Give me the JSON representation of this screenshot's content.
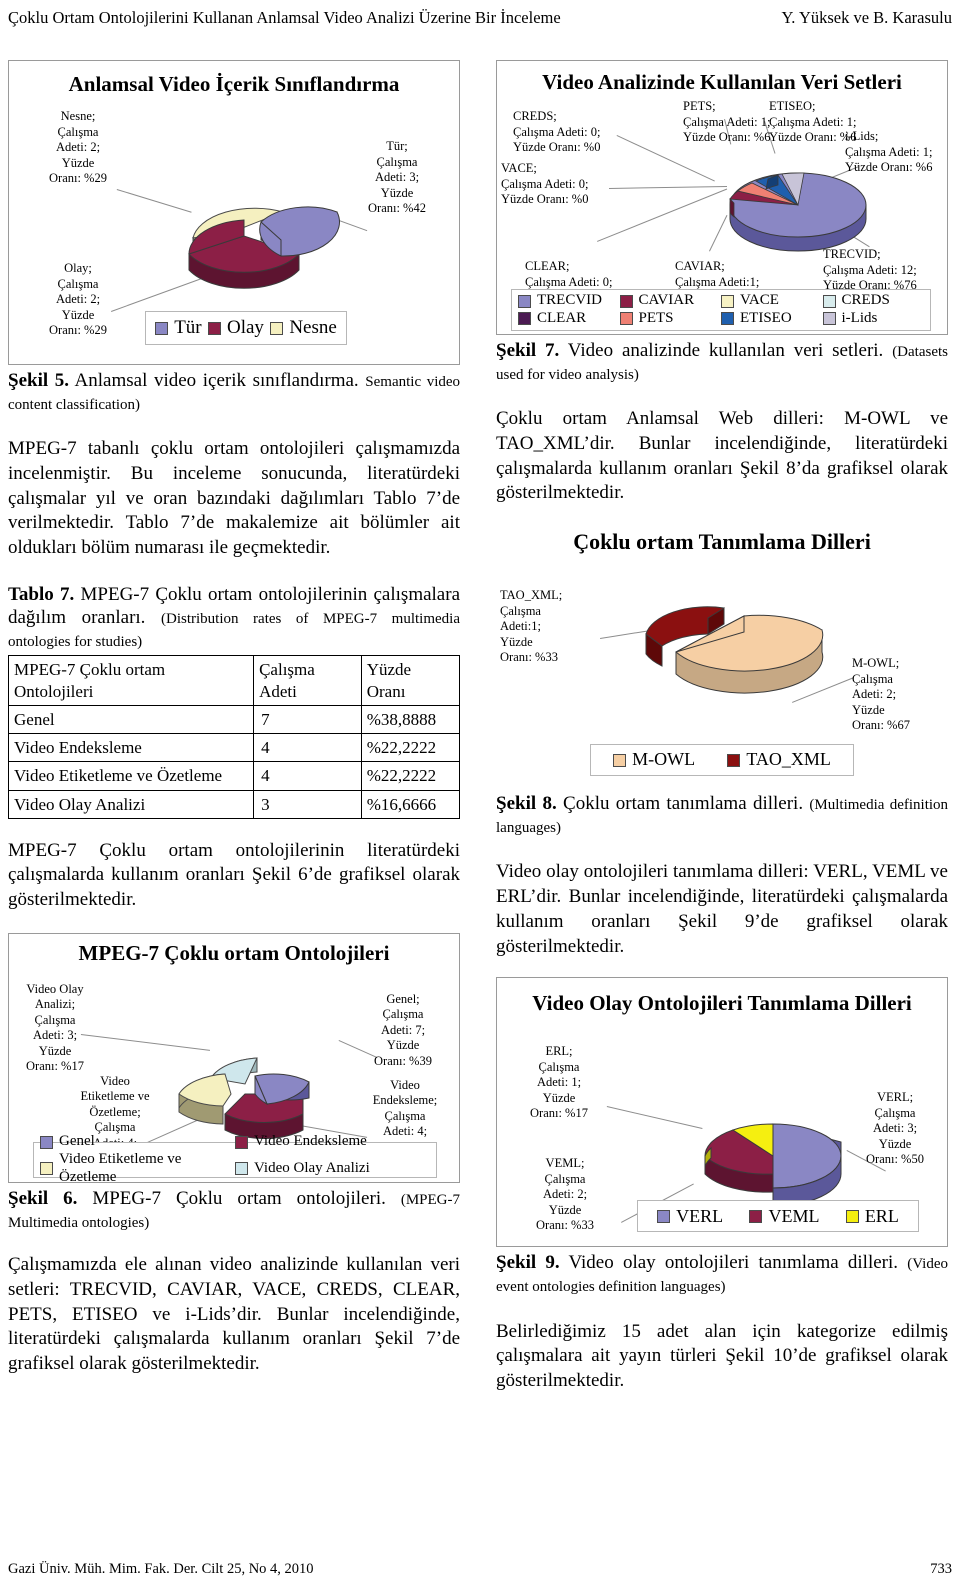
{
  "running_head": {
    "left": "Çoklu Ortam Ontolojilerini Kullanan Anlamsal Video Analizi Üzerine Bir İnceleme",
    "right": "Y. Yüksek ve B. Karasulu"
  },
  "footer": {
    "left": "Gazi Üniv. Müh. Mim. Fak. Der. Cilt 25, No 4, 2010",
    "right": "733"
  },
  "figure5": {
    "caption_bold": "Şekil 5.",
    "caption_tr": "Anlamsal video içerik sınıflandırma.",
    "caption_en": "Semantic video content classification)",
    "chart_data": {
      "type": "pie",
      "title": "Anlamsal Video İçerik Sınıflandırma",
      "categories": [
        "Tür",
        "Olay",
        "Nesne"
      ],
      "values": [
        3,
        2,
        2
      ],
      "percents": [
        42,
        29,
        29
      ],
      "colors": [
        "#8a87c4",
        "#8c1f46",
        "#f5f0c0"
      ],
      "legend": [
        "Tür",
        "Olay",
        "Nesne"
      ],
      "legend_position": "bottom",
      "labels": [
        "Tür;\nÇalışma\nAdeti: 3;\nYüzde\nOranı: %42",
        "Olay;\nÇalışma\nAdeti: 2;\nYüzde\nOranı: %29",
        "Nesne;\nÇalışma\nAdeti: 2;\nYüzde\nOranı: %29"
      ]
    }
  },
  "para1": "MPEG-7 tabanlı çoklu ortam ontolojileri çalışmamızda incelenmiştir. Bu inceleme sonucunda, literatürdeki çalışmalar yıl ve oran bazındaki dağılımları Tablo 7’de verilmektedir. Tablo 7’de makalemize ait bölümler ait oldukları bölüm numarası ile geçmektedir.",
  "table7": {
    "caption_bold": "Tablo 7.",
    "caption_tr": "MPEG-7 Çoklu ortam ontolojilerinin çalışmalara dağılım oranları.",
    "caption_en": "(Distribution rates of MPEG-7 multimedia ontologies for studies)",
    "columns": [
      "MPEG-7 Çoklu ortam Ontolojileri",
      "Çalışma Adeti",
      "Yüzde Oranı"
    ],
    "rows": [
      [
        "Genel",
        "7",
        "%38,8888"
      ],
      [
        "Video Endeksleme",
        "4",
        "%22,2222"
      ],
      [
        "Video Etiketleme ve Özetleme",
        "4",
        "%22,2222"
      ],
      [
        "Video Olay Analizi",
        "3",
        "%16,6666"
      ]
    ]
  },
  "para2": "MPEG-7 Çoklu ortam ontolojilerinin literatürdeki çalışmalarda kullanım oranları Şekil 6’de grafiksel olarak gösterilmektedir.",
  "figure6": {
    "caption_bold": "Şekil 6.",
    "caption_tr": "MPEG-7 Çoklu ortam ontolojileri.",
    "caption_en": "(MPEG-7 Multimedia ontologies)",
    "chart_data": {
      "type": "pie",
      "title": "MPEG-7 Çoklu ortam Ontolojileri",
      "categories": [
        "Genel",
        "Video Endeksleme",
        "Video Etiketleme ve Özetleme",
        "Video Olay Analizi"
      ],
      "values": [
        7,
        4,
        4,
        3
      ],
      "percents": [
        39,
        22,
        22,
        17
      ],
      "colors": [
        "#8a87c4",
        "#8c1f46",
        "#f5f0c0",
        "#cfe7ec"
      ],
      "legend": [
        "Genel",
        "Video Endeksleme",
        "Video Etiketleme ve Özetleme",
        "Video Olay Analizi"
      ],
      "legend_position": "bottom",
      "labels": [
        "Genel;\nÇalışma\nAdeti: 7;\nYüzde\nOranı: %39",
        "Video\nEndeksleme;\nÇalışma\nAdeti: 4;\nYüzde\nOranı: %22",
        "Video\nEtiketleme ve\nÖzetleme;\nÇalışma\nAdeti: 4;\nYüzde\nOranı: %22",
        "Video Olay\nAnalizi;\nÇalışma\nAdeti: 3;\nYüzde\nOranı: %17"
      ]
    }
  },
  "para3": "Çalışmamızda ele alınan video analizinde kullanılan veri setleri: TRECVID, CAVIAR, VACE, CREDS, CLEAR, PETS, ETISEO ve i-Lids’dir. Bunlar incelendiğinde, literatürdeki çalışmalarda kullanım oranları Şekil 7’de grafiksel olarak gösterilmektedir.",
  "figure7": {
    "caption_bold": "Şekil 7.",
    "caption_tr": "Video analizinde kullanılan veri setleri.",
    "caption_en": "(Datasets used for video analysis)",
    "chart_data": {
      "type": "pie",
      "title": "Video Analizinde Kullanılan Veri Setleri",
      "categories": [
        "TRECVID",
        "CAVIAR",
        "VACE",
        "CREDS",
        "CLEAR",
        "PETS",
        "ETISEO",
        "i-Lids"
      ],
      "values": [
        12,
        1,
        0,
        0,
        0,
        1,
        1,
        1
      ],
      "percents": [
        76,
        6,
        0,
        0,
        0,
        6,
        6,
        6
      ],
      "colors": [
        "#8a87c4",
        "#8c1f46",
        "#f7f2c4",
        "#d8eced",
        "#4b1a52",
        "#ef8073",
        "#1f5fae",
        "#c8c4d8"
      ],
      "legend": [
        "TRECVID",
        "CAVIAR",
        "VACE",
        "CREDS",
        "CLEAR",
        "PETS",
        "ETISEO",
        "i-Lids"
      ],
      "legend_position": "bottom",
      "labels": [
        "TRECVID;\nÇalışma Adeti: 12;\nYüzde Oranı: %76",
        "CAVIAR;\nÇalışma Adeti:1;\nYüzde Oranı: %6",
        "VACE;\nÇalışma Adeti: 0;\nYüzde Oranı: %0",
        "CREDS;\nÇalışma Adeti: 0;\nYüzde Oranı: %0",
        "CLEAR;\nÇalışma Adeti: 0;\nYüzde Oranı: %0",
        "PETS;\nÇalışma Adeti: 1;\nYüzde Oranı: %6",
        "ETISEO;\nÇalışma Adeti: 1;\nYüzde Oranı: %6",
        "i-Lids;\nÇalışma Adeti: 1;\nYüzde Oranı: %6"
      ]
    }
  },
  "para4": "Çoklu ortam Anlamsal Web dilleri: M-OWL ve TAO_XML’dir. Bunlar incelendiğinde, literatürdeki çalışmalarda kullanım oranları Şekil 8’da grafiksel olarak gösterilmektedir.",
  "figure8": {
    "caption_bold": "Şekil 8.",
    "caption_tr": "Çoklu ortam tanımlama dilleri.",
    "caption_en": "(Multimedia definition languages)",
    "chart_data": {
      "type": "pie",
      "title": "Çoklu ortam Tanımlama Dilleri",
      "categories": [
        "M-OWL",
        "TAO_XML"
      ],
      "values": [
        2,
        1
      ],
      "percents": [
        67,
        33
      ],
      "colors": [
        "#f6cfa4",
        "#8b1010"
      ],
      "legend": [
        "M-OWL",
        "TAO_XML"
      ],
      "legend_position": "bottom",
      "labels": [
        "M-OWL;\nÇalışma\nAdeti: 2;\nYüzde\nOranı: %67",
        "TAO_XML;\nÇalışma\nAdeti:1;\nYüzde\nOranı: %33"
      ]
    }
  },
  "para5": "Video olay ontolojileri tanımlama dilleri: VERL, VEML ve ERL’dir. Bunlar incelendiğinde, literatürdeki çalışmalarda kullanım oranları Şekil 9’de grafiksel olarak gösterilmektedir.",
  "figure9": {
    "caption_bold": "Şekil 9.",
    "caption_tr": "Video olay ontolojileri tanımlama dilleri.",
    "caption_en": "(Video event ontologies definition languages)",
    "chart_data": {
      "type": "pie",
      "title": "Video Olay Ontolojileri Tanımlama Dilleri",
      "categories": [
        "VERL",
        "VEML",
        "ERL"
      ],
      "values": [
        3,
        2,
        1
      ],
      "percents": [
        50,
        33,
        17
      ],
      "colors": [
        "#8a87c4",
        "#8c1f46",
        "#f5ef10"
      ],
      "legend": [
        "VERL",
        "VEML",
        "ERL"
      ],
      "legend_position": "bottom",
      "labels": [
        "VERL;\nÇalışma\nAdeti: 3;\nYüzde\nOranı: %50",
        "VEML;\nÇalışma\nAdeti: 2;\nYüzde\nOranı: %33",
        "ERL;\nÇalışma\nAdeti: 1;\nYüzde\nOranı: %17"
      ]
    }
  },
  "para6": "Belirlediğimiz 15 adet alan için kategorize edilmiş çalışmalara ait yayın türleri Şekil 10’de grafiksel olarak gösterilmektedir."
}
